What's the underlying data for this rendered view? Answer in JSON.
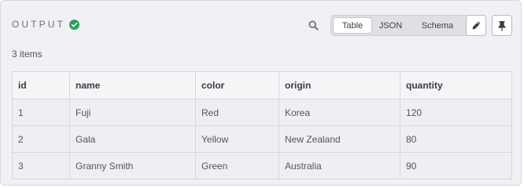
{
  "header": {
    "title": "OUTPUT",
    "status_icon": "check-circle-icon",
    "search_icon": "search-icon",
    "view_tabs": [
      {
        "label": "Table",
        "active": true
      },
      {
        "label": "JSON",
        "active": false
      },
      {
        "label": "Schema",
        "active": false
      }
    ],
    "edit_icon": "pencil-icon",
    "pin_icon": "pin-icon"
  },
  "summary": {
    "item_count": "3 items"
  },
  "table": {
    "columns": [
      "id",
      "name",
      "color",
      "origin",
      "quantity"
    ],
    "rows": [
      [
        "1",
        "Fuji",
        "Red",
        "Korea",
        "120"
      ],
      [
        "2",
        "Gala",
        "Yellow",
        "New Zealand",
        "80"
      ],
      [
        "3",
        "Granny Smith",
        "Green",
        "Australia",
        "90"
      ]
    ]
  },
  "colors": {
    "success": "#2e9e5b",
    "panel_bg": "#f0f1f5",
    "border": "#d7d8de"
  }
}
